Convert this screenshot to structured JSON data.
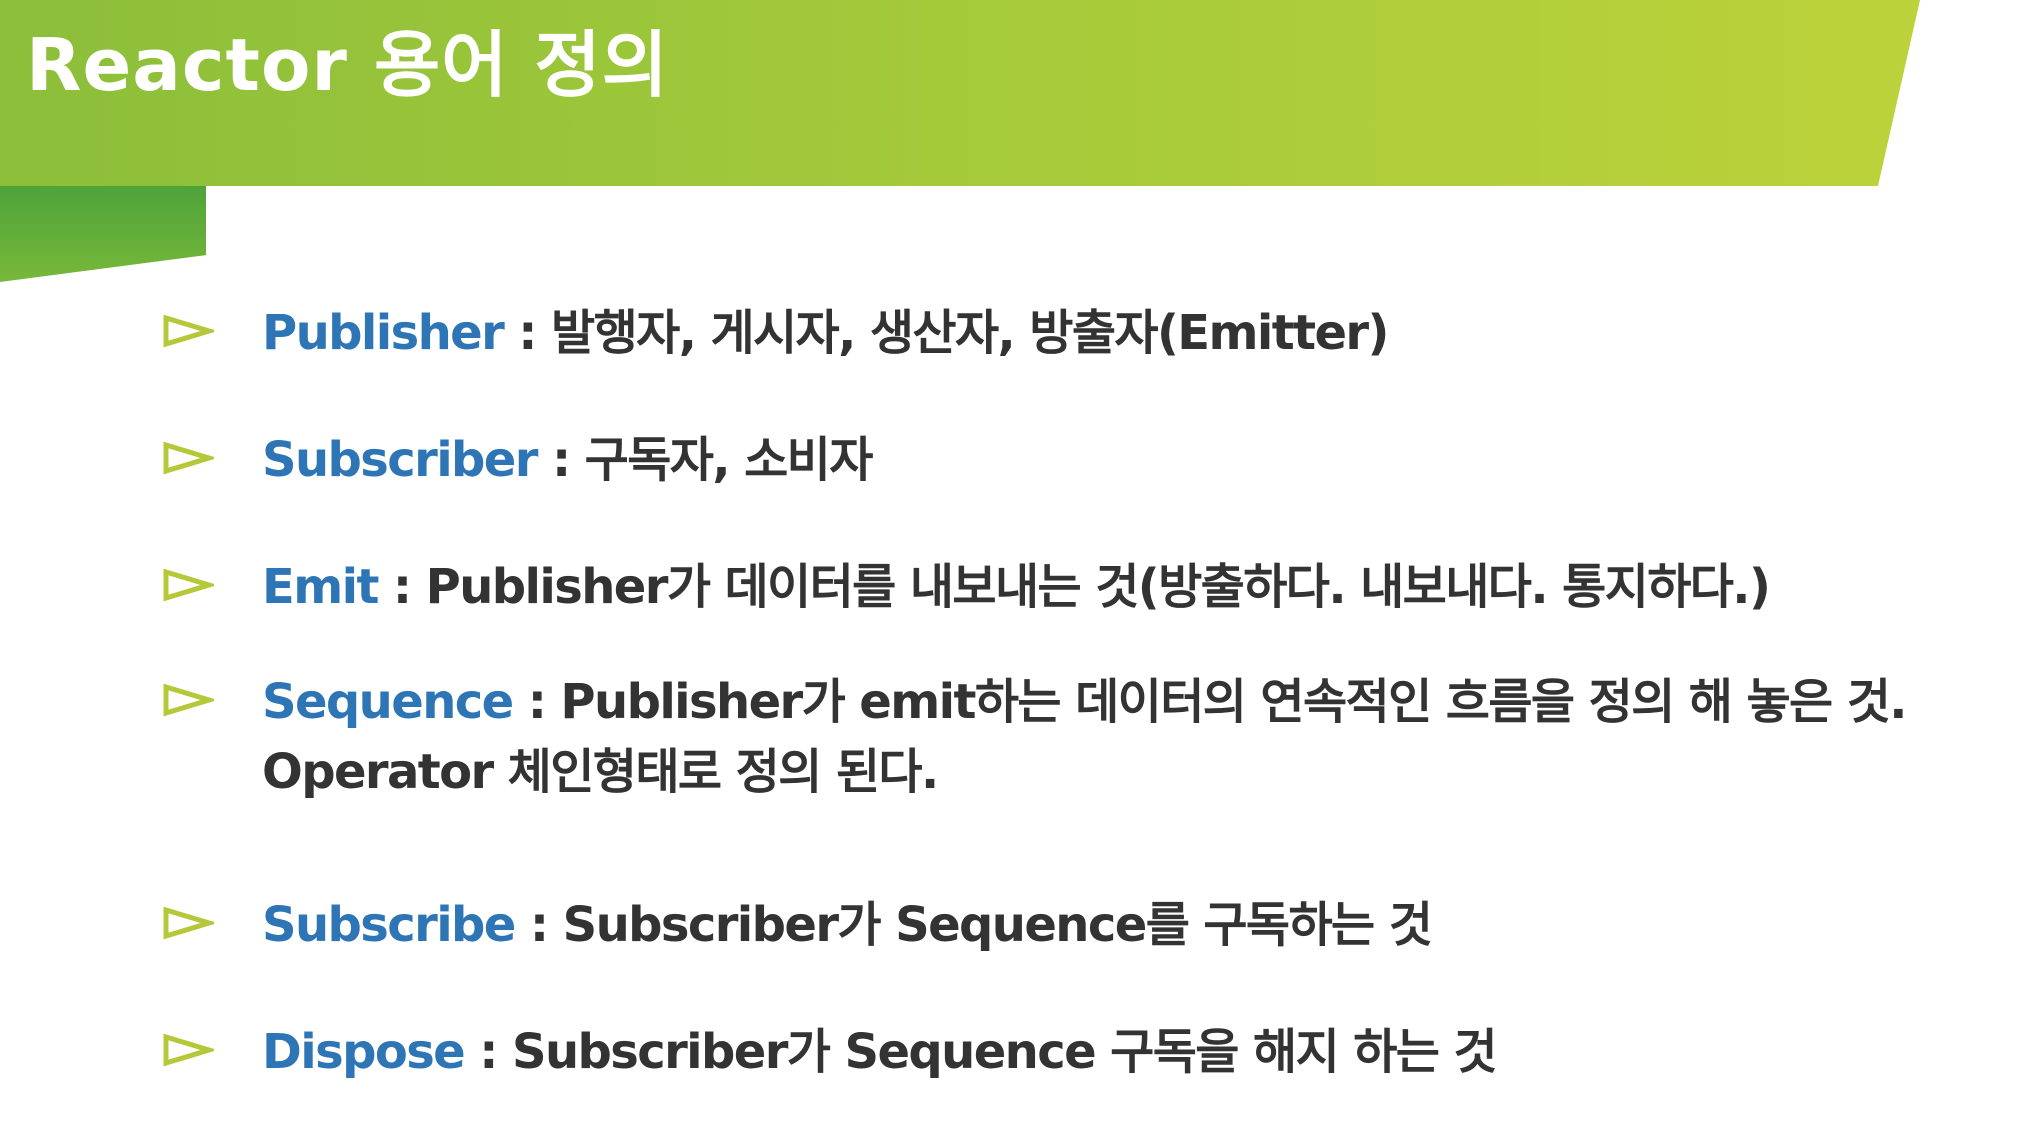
{
  "title": "Reactor 용어 정의",
  "colors": {
    "header_green": "#a2c93a",
    "header_dark_green": "#4ea33a",
    "term_blue": "#2e75b6",
    "text_dark": "#333333",
    "bullet_outline": "#b6c83a"
  },
  "bullet_icon": "triangle-outline-bullet-icon",
  "terms": [
    {
      "term": "Publisher",
      "separator": " : ",
      "definition": "발행자, 게시자, 생산자, 방출자(Emitter)"
    },
    {
      "term": "Subscriber",
      "separator": " : ",
      "definition": "구독자, 소비자"
    },
    {
      "term": "Emit",
      "separator": " : ",
      "definition": "Publisher가 데이터를 내보내는 것(방출하다. 내보내다. 통지하다.)"
    },
    {
      "term": "Sequence",
      "separator": " : ",
      "definition": "Publisher가 emit하는 데이터의 연속적인 흐름을 정의 해 놓은 것.",
      "definition_line2": "Operator 체인형태로 정의 된다."
    },
    {
      "term": "Subscribe",
      "separator": " : ",
      "definition": "Subscriber가 Sequence를 구독하는 것"
    },
    {
      "term": "Dispose",
      "separator": " : ",
      "definition": "Subscriber가 Sequence 구독을 해지 하는 것"
    }
  ]
}
